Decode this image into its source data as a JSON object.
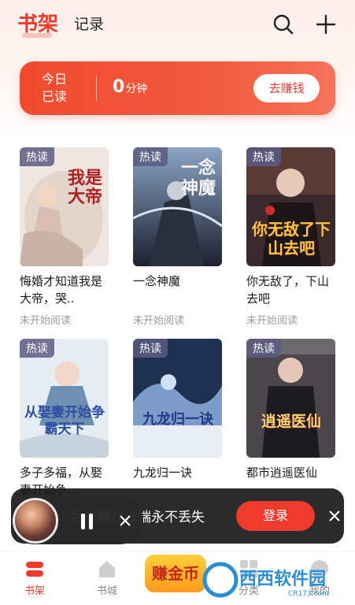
{
  "header": {
    "tab_active": "书架",
    "tab_other": "记录",
    "icons": [
      "search-icon",
      "plus-icon"
    ]
  },
  "reading_card": {
    "label": "今日 已读",
    "value": "0",
    "unit": "分钟",
    "button": "去赚钱"
  },
  "books": [
    {
      "badge": "热读",
      "title": "悔婚才知道我是大帝，哭..",
      "status": "未开始阅读",
      "cover_title": "我是大帝"
    },
    {
      "badge": "热读",
      "title": "一念神魔",
      "status": "未开始阅读",
      "cover_title": "一念神魔"
    },
    {
      "badge": "热读",
      "title": "你无敌了，下山去吧",
      "status": "未开始阅读",
      "cover_title": "你无敌了下山去吧"
    },
    {
      "badge": "热读",
      "title": "多子多福，从娶妻开始争..",
      "status": "",
      "cover_title": "从娶妻开始争霸天下"
    },
    {
      "badge": "热读",
      "title": "九龙归一诀",
      "status": "",
      "cover_title": "九龙归一诀"
    },
    {
      "badge": "热读",
      "title": "都市逍遥医仙",
      "status": "",
      "cover_title": "逍遥医仙"
    }
  ],
  "sync_banner": {
    "text": "后书籍在云端永不丢失",
    "login_button": "登录"
  },
  "bottom_nav": {
    "items": [
      "书架",
      "书城",
      "分类",
      "我的"
    ],
    "earn_label": "赚金币"
  },
  "watermark": {
    "text": "西西软件园",
    "domain": "CR173.com"
  },
  "colors": {
    "accent": "#ee3b2c",
    "badge": "#5a5a82"
  }
}
